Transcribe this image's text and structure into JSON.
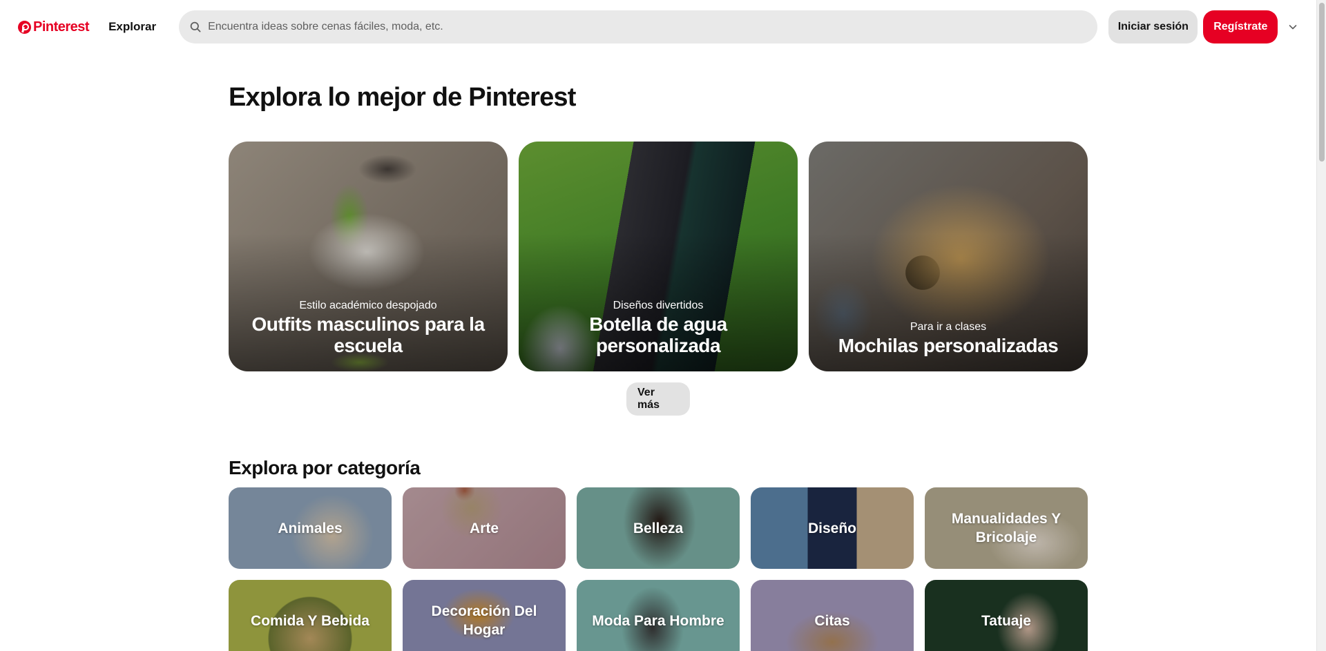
{
  "header": {
    "logo_text": "Pinterest",
    "nav_explore": "Explorar",
    "search_placeholder": "Encuentra ideas sobre cenas fáciles, moda, etc.",
    "login_label": "Iniciar sesión",
    "signup_label": "Regístrate",
    "brand_color": "#e60023"
  },
  "main": {
    "title": "Explora lo mejor de Pinterest",
    "featured": [
      {
        "subtitle": "Estilo académico despojado",
        "title": "Outfits masculinos para la escuela"
      },
      {
        "subtitle": "Diseños divertidos",
        "title": "Botella de agua personalizada"
      },
      {
        "subtitle": "Para ir a clases",
        "title": "Mochilas personalizadas"
      }
    ],
    "more_label": "Ver más",
    "categories_title": "Explora por categoría",
    "categories": [
      "Animales",
      "Arte",
      "Belleza",
      "Diseño",
      "Manualidades Y Bricolaje",
      "Comida Y Bebida",
      "Decoración Del Hogar",
      "Moda Para Hombre",
      "Citas",
      "Tatuaje"
    ]
  },
  "icons": {
    "logo": "pinterest-logo-icon",
    "search": "search-icon",
    "menu": "chevron-down-icon"
  }
}
